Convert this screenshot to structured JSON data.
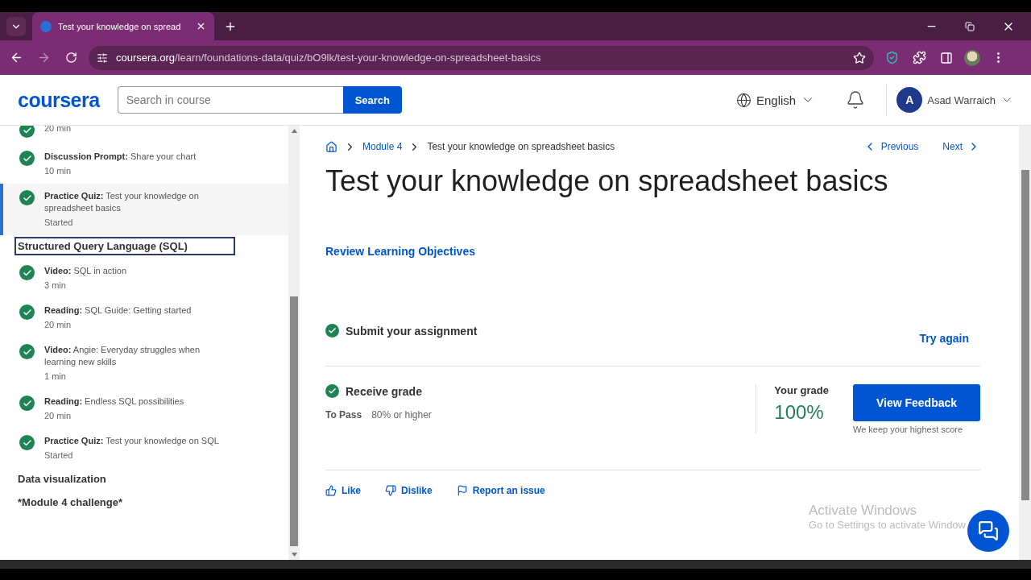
{
  "browser": {
    "tab_title": "Test your knowledge on spread",
    "url_host": "coursera.org",
    "url_path": "/learn/foundations-data/quiz/bO9lk/test-your-knowledge-on-spreadsheet-basics"
  },
  "header": {
    "logo": "coursera",
    "search": {
      "placeholder": "Search in course",
      "button": "Search"
    },
    "language": "English",
    "user": {
      "initial": "A",
      "name": "Asad Warraich"
    }
  },
  "sidebar": {
    "items": [
      {
        "kind": "item",
        "meta": "20 min",
        "completed": true,
        "selected": false
      },
      {
        "kind": "item",
        "text": "**Discussion Prompt:** Share your chart",
        "meta": "10 min",
        "completed": true,
        "selected": false
      },
      {
        "kind": "item",
        "text": "**Practice Quiz:** Test your knowledge on spreadsheet basics",
        "meta": "Started",
        "completed": true,
        "selected": true
      },
      {
        "kind": "heading",
        "heading": "Structured Query Language (SQL)",
        "focused": true
      },
      {
        "kind": "item",
        "text": "**Video:** SQL in action",
        "meta": "3 min",
        "completed": true,
        "selected": false
      },
      {
        "kind": "item",
        "text": "**Reading:** SQL Guide: Getting started",
        "meta": "20 min",
        "completed": true,
        "selected": false
      },
      {
        "kind": "item",
        "text": "**Video:** Angie: Everyday struggles when learning new skills",
        "meta": "1 min",
        "completed": true,
        "selected": false
      },
      {
        "kind": "item",
        "text": "**Reading:** Endless SQL possibilities",
        "meta": "20 min",
        "completed": true,
        "selected": false
      },
      {
        "kind": "item",
        "text": "**Practice Quiz:** Test your knowledge on SQL",
        "meta": "Started",
        "completed": true,
        "selected": false
      },
      {
        "kind": "heading",
        "heading": "Data visualization",
        "focused": false
      },
      {
        "kind": "heading",
        "heading": "*Module 4 challenge*",
        "focused": false
      }
    ]
  },
  "main": {
    "breadcrumb": [
      "Module 4",
      "Test your knowledge on spreadsheet basics"
    ],
    "previous": "Previous",
    "next": "Next",
    "title": "Test your knowledge on spreadsheet basics",
    "objectives_link": "Review Learning Objectives",
    "submit": {
      "label": "Submit your assignment",
      "completed": true,
      "action": "Try again"
    },
    "receive": {
      "label": "Receive grade",
      "completed": true,
      "pass_label": "To Pass",
      "pass_value": "80% or higher"
    },
    "grade": {
      "label": "Your grade",
      "value": "100%",
      "button": "View Feedback",
      "note": "We keep your highest score"
    },
    "feedback": [
      "Like",
      "Dislike",
      "Report an issue"
    ]
  },
  "os_notice": {
    "title": "Activate Windows",
    "text": "Go to Settings to activate Window"
  }
}
